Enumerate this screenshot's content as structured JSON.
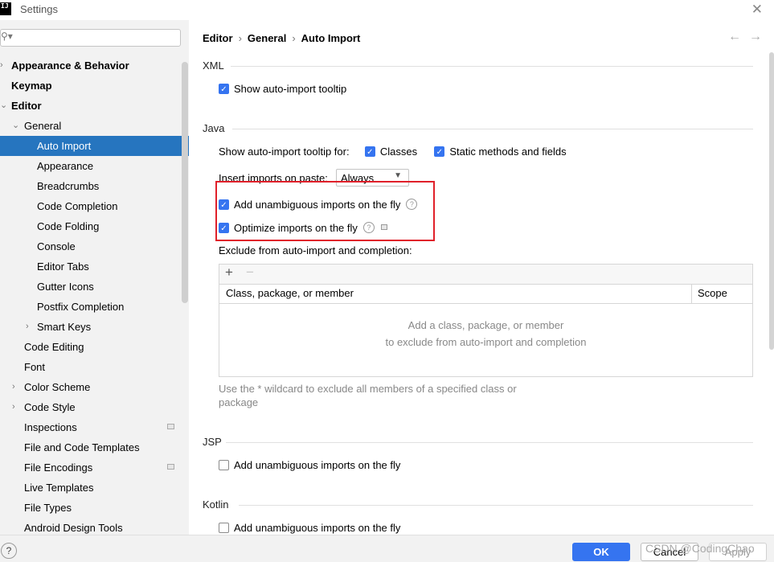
{
  "window": {
    "title": "Settings",
    "logo": "IJ"
  },
  "search": {
    "placeholder": "",
    "value": ""
  },
  "sidebar": {
    "items": [
      {
        "label": "Appearance & Behavior",
        "arrow": "›"
      },
      {
        "label": "Keymap"
      },
      {
        "label": "Editor",
        "arrow": "⌄"
      },
      {
        "label": "General",
        "arrow": "⌄"
      },
      {
        "label": "Auto Import",
        "selected": true
      },
      {
        "label": "Appearance"
      },
      {
        "label": "Breadcrumbs"
      },
      {
        "label": "Code Completion"
      },
      {
        "label": "Code Folding"
      },
      {
        "label": "Console"
      },
      {
        "label": "Editor Tabs"
      },
      {
        "label": "Gutter Icons"
      },
      {
        "label": "Postfix Completion"
      },
      {
        "label": "Smart Keys",
        "arrow": "›"
      },
      {
        "label": "Code Editing"
      },
      {
        "label": "Font"
      },
      {
        "label": "Color Scheme",
        "arrow": "›"
      },
      {
        "label": "Code Style",
        "arrow": "›"
      },
      {
        "label": "Inspections"
      },
      {
        "label": "File and Code Templates"
      },
      {
        "label": "File Encodings"
      },
      {
        "label": "Live Templates"
      },
      {
        "label": "File Types"
      },
      {
        "label": "Android Design Tools"
      }
    ]
  },
  "breadcrumb": {
    "items": [
      "Editor",
      "General",
      "Auto Import"
    ],
    "separator": "›"
  },
  "nav": {
    "back": "←",
    "forward": "→"
  },
  "xml": {
    "title": "XML",
    "show_tooltip": {
      "label": "Show auto-import tooltip",
      "checked": true
    }
  },
  "java": {
    "title": "Java",
    "tooltip_for_label": "Show auto-import tooltip for:",
    "classes": {
      "label": "Classes",
      "checked": true
    },
    "static_methods": {
      "label": "Static methods and fields",
      "checked": true
    },
    "insert_on_paste_label": "Insert imports on paste:",
    "insert_on_paste_value": "Always",
    "add_unambiguous": {
      "label": "Add unambiguous imports on the fly",
      "checked": true
    },
    "optimize": {
      "label": "Optimize imports on the fly",
      "checked": true
    },
    "exclude_label": "Exclude from auto-import and completion:",
    "table": {
      "add": "+",
      "remove": "−",
      "columns": [
        "Class, package, or member",
        "Scope"
      ],
      "empty_line1": "Add a class, package, or member",
      "empty_line2": "to exclude from auto-import and completion"
    },
    "hint_line1": "Use the * wildcard to exclude all members of a specified class or",
    "hint_line2": "package"
  },
  "jsp": {
    "title": "JSP",
    "add_unambiguous": {
      "label": "Add unambiguous imports on the fly",
      "checked": false
    }
  },
  "kotlin": {
    "title": "Kotlin",
    "add_unambiguous": {
      "label": "Add unambiguous imports on the fly",
      "checked": false
    }
  },
  "footer": {
    "help": "?",
    "ok": "OK",
    "cancel": "Cancel",
    "apply": "Apply",
    "watermark": "CSDN @CodingChao"
  },
  "colors": {
    "accent": "#3574f0",
    "selection": "#2675bf",
    "highlight_box": "#e0202a"
  }
}
